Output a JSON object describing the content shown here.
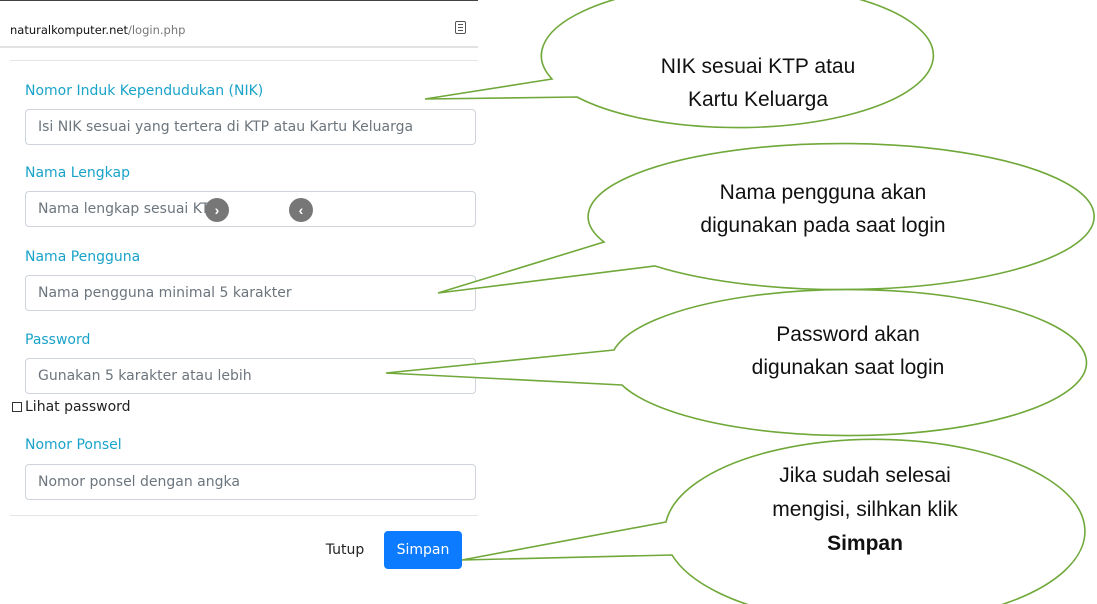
{
  "browser": {
    "url_host": "naturalkomputer.net",
    "url_path": "/login.php",
    "reader_icon": "reader-mode-icon"
  },
  "form": {
    "nik": {
      "label": "Nomor Induk Kependudukan (NIK)",
      "placeholder": "Isi NIK sesuai yang tertera di KTP atau Kartu Keluarga"
    },
    "nama_lengkap": {
      "label": "Nama Lengkap",
      "placeholder": "Nama lengkap sesuai KTP"
    },
    "nama_pengguna": {
      "label": "Nama Pengguna",
      "placeholder": "Nama pengguna minimal 5 karakter"
    },
    "password": {
      "label": "Password",
      "placeholder": "Gunakan 5 karakter atau lebih",
      "show_password_label": "Lihat password"
    },
    "ponsel": {
      "label": "Nomor Ponsel",
      "placeholder": "Nomor ponsel dengan angka"
    }
  },
  "slider": {
    "next_glyph": "›",
    "prev_glyph": "‹"
  },
  "buttons": {
    "tutup": "Tutup",
    "simpan": "Simpan"
  },
  "callouts": {
    "nik": {
      "line1": "NIK sesuai KTP atau",
      "line2": "Kartu Keluarga"
    },
    "nama_pengguna": {
      "line1": "Nama pengguna akan",
      "line2": "digunakan pada saat login"
    },
    "password": {
      "line1": "Password akan",
      "line2": "digunakan saat login"
    },
    "simpan": {
      "line1": "Jika sudah selesai",
      "line2": "mengisi, silhkan klik",
      "line3": "Simpan"
    }
  },
  "colors": {
    "label": "#1aa3c9",
    "primary_button": "#0d7bff",
    "callout_stroke": "#70a83a"
  }
}
